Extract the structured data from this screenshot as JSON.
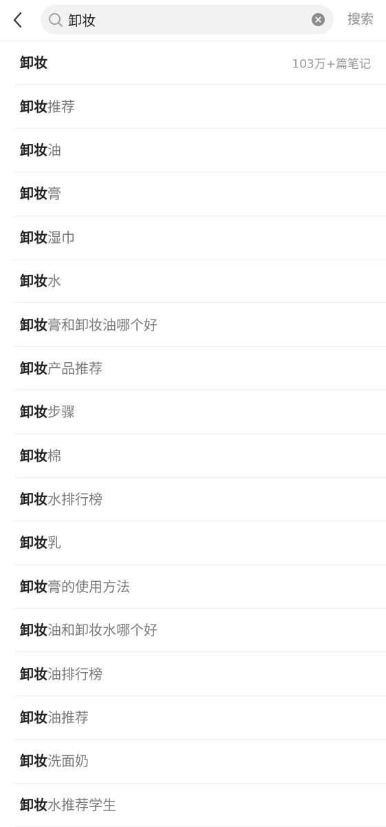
{
  "header": {
    "search": {
      "value": "卸妆",
      "placeholder": ""
    },
    "search_button_label": "搜索",
    "icons": {
      "back": "chevron-left-icon",
      "search": "search-icon",
      "clear": "clear-circle-icon"
    }
  },
  "suggestions": [
    {
      "keyword": "卸妆",
      "rest": "",
      "note_count": "103万+篇笔记"
    },
    {
      "keyword": "卸妆",
      "rest": "推荐"
    },
    {
      "keyword": "卸妆",
      "rest": "油"
    },
    {
      "keyword": "卸妆",
      "rest": "膏"
    },
    {
      "keyword": "卸妆",
      "rest": "湿巾"
    },
    {
      "keyword": "卸妆",
      "rest": "水"
    },
    {
      "keyword": "卸妆",
      "rest": "膏和卸妆油哪个好"
    },
    {
      "keyword": "卸妆",
      "rest": "产品推荐"
    },
    {
      "keyword": "卸妆",
      "rest": "步骤"
    },
    {
      "keyword": "卸妆",
      "rest": "棉"
    },
    {
      "keyword": "卸妆",
      "rest": "水排行榜"
    },
    {
      "keyword": "卸妆",
      "rest": "乳"
    },
    {
      "keyword": "卸妆",
      "rest": "膏的使用方法"
    },
    {
      "keyword": "卸妆",
      "rest": "油和卸妆水哪个好"
    },
    {
      "keyword": "卸妆",
      "rest": "油排行榜"
    },
    {
      "keyword": "卸妆",
      "rest": "油推荐"
    },
    {
      "keyword": "卸妆",
      "rest": "洗面奶"
    },
    {
      "keyword": "卸妆",
      "rest": "水推荐学生"
    }
  ],
  "colors": {
    "keyword": "#222222",
    "suggestion_rest": "#7a7a7a",
    "search_field_bg": "#f2f2f2",
    "divider": "#efefef"
  }
}
